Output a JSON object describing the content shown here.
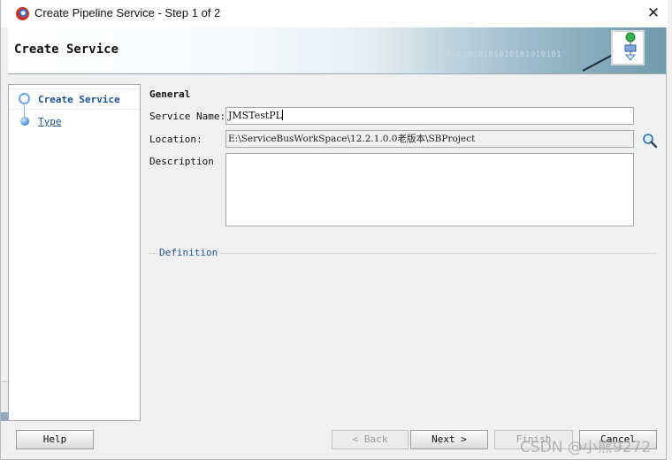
{
  "window": {
    "title": "Create Pipeline Service - Step 1 of 2",
    "close_glyph": "✕"
  },
  "banner": {
    "title": "Create Service",
    "binary_text": "0101010101010101010101",
    "icon": "pipeline-wizard-icon"
  },
  "nav": {
    "items": [
      {
        "label": "Create Service",
        "state": "active"
      },
      {
        "label": "Type",
        "state": "link"
      }
    ]
  },
  "form": {
    "section": "General",
    "service_name": {
      "label": "Service Name:",
      "value": "JMSTestPL"
    },
    "location": {
      "label": "Location:",
      "value": "E:\\ServiceBusWorkSpace\\12.2.1.0.0老版本\\SBProject"
    },
    "description": {
      "label": "Description",
      "value": ""
    },
    "definition_label": "Definition"
  },
  "buttons": {
    "help": "Help",
    "back": "< Back",
    "next": "Next >",
    "finish": "Finish",
    "cancel": "Cancel"
  },
  "watermark": "CSDN @小熊9272",
  "colors": {
    "link": "#1b4f8a",
    "banner_accent": "#6f99ad",
    "bullet": "#3f86d4"
  },
  "icons": {
    "search": "magnifier-icon",
    "step_bullet": "circle-bullet-icon"
  }
}
